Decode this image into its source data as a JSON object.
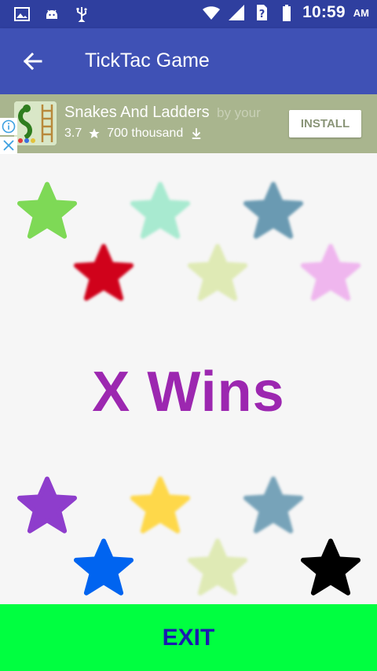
{
  "status_bar": {
    "time": "10:59",
    "ampm": "AM",
    "left_icons": [
      "image-icon",
      "android-icon",
      "usb-icon"
    ],
    "right_icons": [
      "wifi-icon",
      "cell-signal-icon",
      "no-sim-icon",
      "battery-icon"
    ]
  },
  "app_bar": {
    "title": "TickTac Game",
    "back_icon": "arrow-left-icon",
    "color": "#3f51b5"
  },
  "ad": {
    "app_name": "Snakes And Ladders",
    "ghost_text": "by your",
    "rating": "3.7",
    "downloads": "700 thousand",
    "install_label": "INSTALL",
    "background": "#a9b58e"
  },
  "result": {
    "text": "X Wins",
    "color": "#9c27b0"
  },
  "stars": {
    "colors": [
      "#7ed956",
      "#a8ead0",
      "#6a9ab2",
      "#d0021b",
      "#dfeab5",
      "#efb6ee",
      "#8e3dcc",
      "#fed84a",
      "#77a3b9",
      "#0064f0",
      "#dfeab5",
      "#000000"
    ]
  },
  "exit": {
    "label": "EXIT",
    "background": "#00ff40",
    "text_color": "#1a1ab0"
  }
}
